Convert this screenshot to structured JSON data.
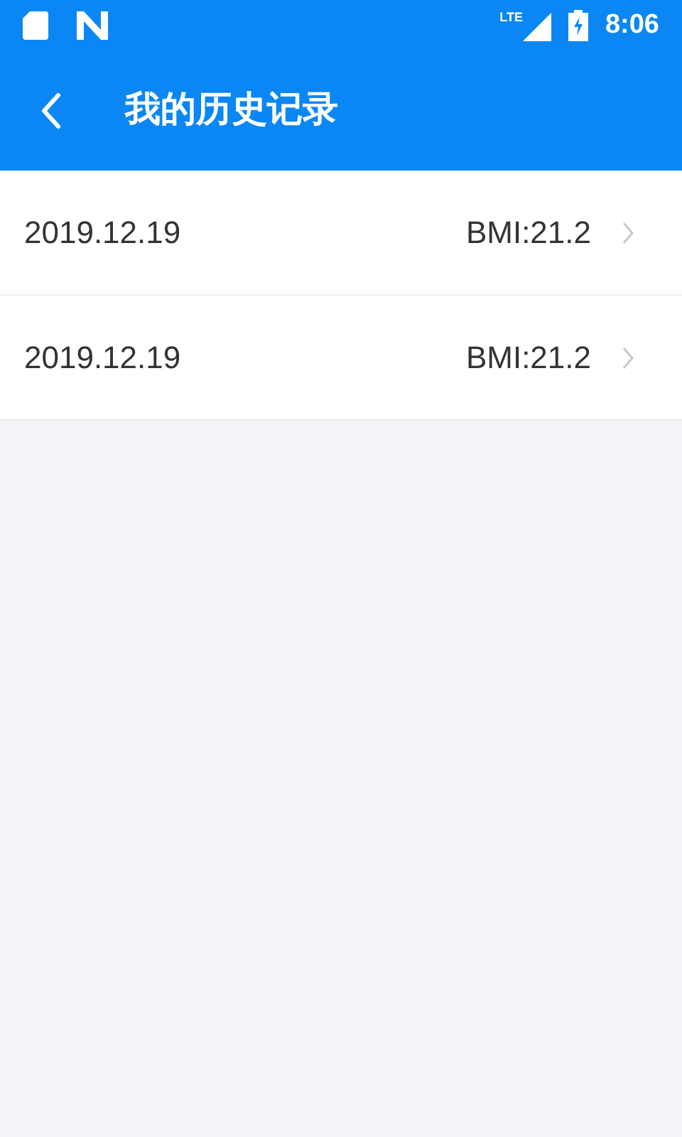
{
  "status_bar": {
    "network": "LTE",
    "time": "8:06"
  },
  "header": {
    "title": "我的历史记录"
  },
  "records": [
    {
      "date": "2019.12.19",
      "value": "BMI:21.2"
    },
    {
      "date": "2019.12.19",
      "value": "BMI:21.2"
    }
  ]
}
